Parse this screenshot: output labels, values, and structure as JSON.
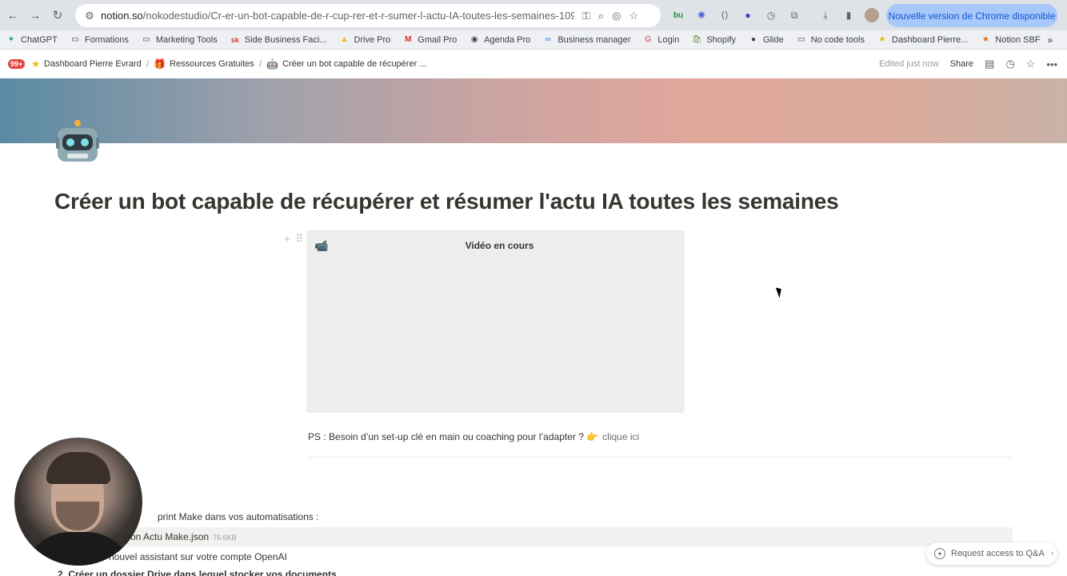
{
  "browser": {
    "url_host": "notion.so",
    "url_path": "/nokodestudio/Cr-er-un-bot-capable-de-r-cup-rer-et-r-sumer-l-actu-IA-toutes-les-semaines-10973...",
    "update_label": "Nouvelle version de Chrome disponible",
    "bookmarks": [
      "ChatGPT",
      "Formations",
      "Marketing Tools",
      "Side Business Faci...",
      "Drive Pro",
      "Gmail Pro",
      "Agenda Pro",
      "Business manager",
      "Login",
      "Shopify",
      "Glide",
      "No code tools",
      "Dashboard Pierre...",
      "Notion SBF"
    ]
  },
  "notion": {
    "notif_badge": "99+",
    "breadcrumbs": [
      "Dashboard Pierre Evrard",
      "Ressources Gratuites",
      "Créer un bot capable de récupérer ..."
    ],
    "edited": "Edited just now",
    "share": "Share",
    "page_title": "Créer un bot capable de récupérer et résumer l'actu IA toutes les semaines",
    "video_emoji": "📹",
    "video_title": "Vidéo en cours",
    "ps_text": "PS : Besoin d’un set-up clé en main ou coaching pour l’adapter ? 👉",
    "ps_link": "clique ici",
    "line1": "print Make dans vos automatisations :",
    "file_name": "on Actu Make.json",
    "file_size": "76.6KB",
    "line3": "nouvel assistant sur votre compte OpenAI",
    "line4": "2.   Créer un dossier Drive dans lequel stocker vos documents",
    "qa_label": "Request access to Q&A"
  }
}
